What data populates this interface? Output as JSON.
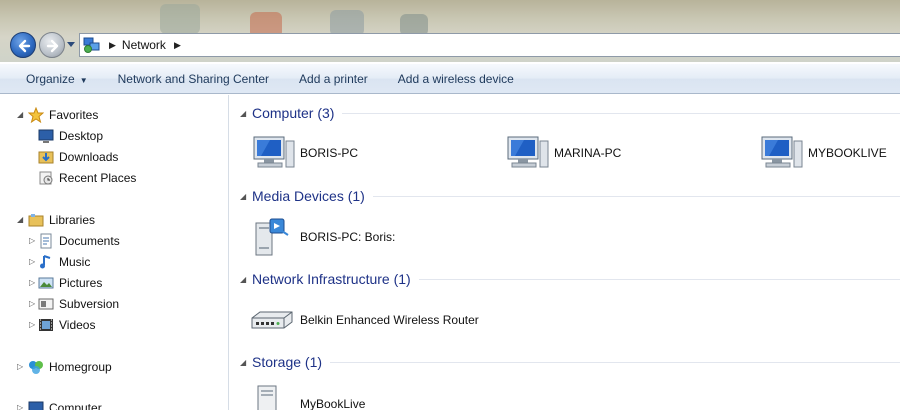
{
  "address": {
    "location": "Network"
  },
  "toolbar": {
    "organize": "Organize",
    "network_sharing": "Network and Sharing Center",
    "add_printer": "Add a printer",
    "add_wireless": "Add a wireless device"
  },
  "nav": {
    "favorites": {
      "label": "Favorites",
      "items": [
        "Desktop",
        "Downloads",
        "Recent Places"
      ]
    },
    "libraries": {
      "label": "Libraries",
      "items": [
        "Documents",
        "Music",
        "Pictures",
        "Subversion",
        "Videos"
      ]
    },
    "homegroup": "Homegroup",
    "computer": "Computer"
  },
  "groups": {
    "computer": {
      "title": "Computer (3)",
      "items": [
        "BORIS-PC",
        "MARINA-PC",
        "MYBOOKLIVE"
      ]
    },
    "media": {
      "title": "Media Devices (1)",
      "items": [
        "BORIS-PC: Boris:"
      ]
    },
    "infrastructure": {
      "title": "Network Infrastructure (1)",
      "items": [
        "Belkin Enhanced Wireless Router"
      ]
    },
    "storage": {
      "title": "Storage (1)",
      "items": [
        "MyBookLive"
      ]
    }
  },
  "colors": {
    "accent": "#1e3287",
    "command_text": "#1e395b",
    "nav_back": "#2f6bc2"
  },
  "icons": [
    "back-arrow-icon",
    "forward-arrow-icon",
    "network-icon",
    "star-icon",
    "desktop-icon",
    "downloads-icon",
    "recent-places-icon",
    "library-icon",
    "documents-icon",
    "music-icon",
    "pictures-icon",
    "subversion-icon",
    "videos-icon",
    "homegroup-icon",
    "computer-icon",
    "monitor-icon",
    "media-device-icon",
    "router-icon",
    "storage-icon"
  ]
}
